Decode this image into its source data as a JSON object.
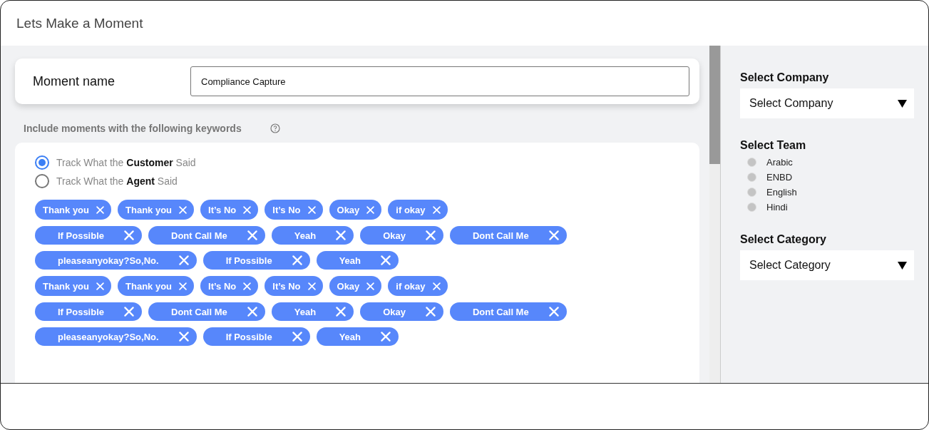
{
  "window": {
    "title": "Lets Make a Moment"
  },
  "moment_name": {
    "label": "Moment name",
    "value": "Compliance Capture"
  },
  "keywords": {
    "label": "Include moments with the following keywords",
    "track_options": [
      {
        "label": "Track What the **Customer** Said",
        "selected": true
      },
      {
        "label": "Track What the **Agent** Said",
        "selected": false
      }
    ],
    "tag_rows": [
      [
        "Thank you",
        "Thank you",
        "It’s No",
        "It’s No",
        "Okay",
        "if okay"
      ],
      [
        "If Possible",
        "Dont Call Me",
        "Yeah",
        "Okay",
        "Dont Call Me"
      ],
      [
        "pleaseanyokay?So,No.",
        "If Possible",
        "Yeah"
      ],
      [
        "Thank you",
        "Thank you",
        "It’s No",
        "It’s No",
        "Okay",
        "if okay"
      ],
      [
        "If Possible",
        "Dont Call Me",
        "Yeah",
        "Okay",
        "Dont Call Me"
      ],
      [
        "pleaseanyokay?So,No.",
        "If Possible",
        "Yeah"
      ]
    ]
  },
  "sidebar": {
    "company": {
      "label": "Select Company",
      "value": "Select Company"
    },
    "team": {
      "label": "Select Team",
      "options": [
        {
          "label": "Arabic",
          "selected": false
        },
        {
          "label": "ENBD",
          "selected": false
        },
        {
          "label": "English",
          "selected": false
        },
        {
          "label": "Hindi",
          "selected": false
        }
      ]
    },
    "category": {
      "label": "Select Category",
      "value": "Select Category"
    }
  }
}
